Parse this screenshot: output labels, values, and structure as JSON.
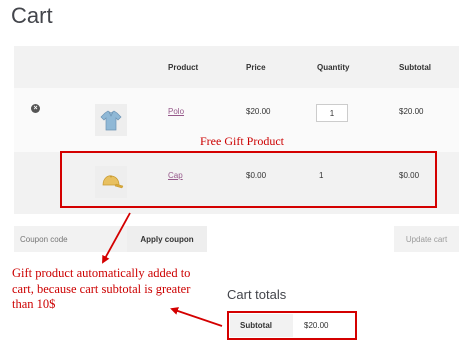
{
  "page": {
    "title": "Cart"
  },
  "table": {
    "headers": {
      "product": "Product",
      "price": "Price",
      "quantity": "Quantity",
      "subtotal": "Subtotal"
    },
    "rows": [
      {
        "product": "Polo",
        "price": "$20.00",
        "quantity": "1",
        "subtotal": "$20.00",
        "removable": true
      },
      {
        "product": "Cap",
        "price": "$0.00",
        "quantity": "1",
        "subtotal": "$0.00",
        "removable": false
      }
    ]
  },
  "coupon": {
    "placeholder": "Coupon code",
    "apply_label": "Apply coupon"
  },
  "update_label": "Update cart",
  "cart_totals": {
    "title": "Cart totals",
    "subtotal_label": "Subtotal",
    "subtotal_value": "$20.00"
  },
  "annotations": {
    "free_gift": "Free Gift Product",
    "auto_added": "Gift product automatically added to cart, because cart subtotal is greater than 10$"
  },
  "colors": {
    "accent_link": "#96588a",
    "annotation_red": "#d40000",
    "header_bg": "#f2f2f2"
  },
  "icons": {
    "remove": "remove-circle-icon",
    "polo": "polo-shirt-icon",
    "cap": "cap-icon"
  }
}
